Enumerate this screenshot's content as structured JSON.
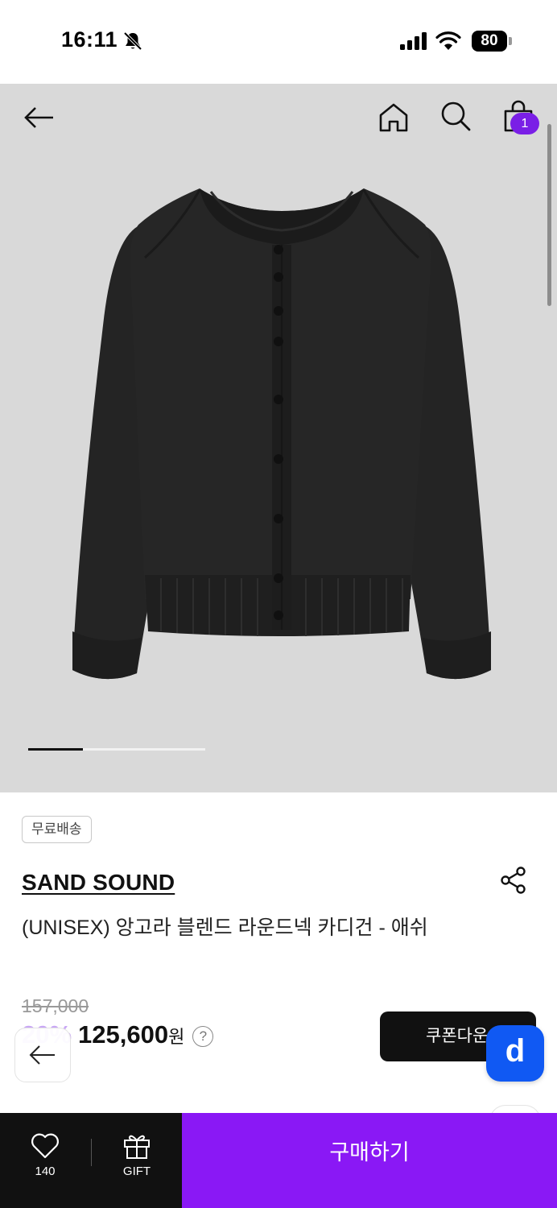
{
  "status_bar": {
    "time": "16:11",
    "battery": "80",
    "icons": [
      "bell-off-icon",
      "signal-icon",
      "wifi-icon",
      "battery-icon"
    ]
  },
  "top_nav": {
    "icons": [
      "back-arrow-icon",
      "home-icon",
      "search-icon",
      "shopping-bag-icon"
    ],
    "cart_count": "1"
  },
  "gallery": {
    "image": "black-cardigan-product-photo",
    "image_progress": 0.5
  },
  "product": {
    "badge": "무료배송",
    "brand": "SAND SOUND",
    "name": "(UNISEX) 앙고라 블렌드 라운드넥 카디건 - 애쉬",
    "original_price": "157,000",
    "discount": "20%",
    "price": "125,600",
    "currency": "원",
    "price_help": "?"
  },
  "actions": {
    "coupon_label": "쿠폰다운",
    "floating_app_label": "d",
    "wish_count": "140",
    "gift_label": "GIFT",
    "buy_label": "구매하기"
  },
  "colors": {
    "accent_purple": "#8a18f5",
    "badge_purple": "#7a1fe6",
    "app_blue": "#1059f3",
    "hero_bg": "#d9d9d9"
  }
}
